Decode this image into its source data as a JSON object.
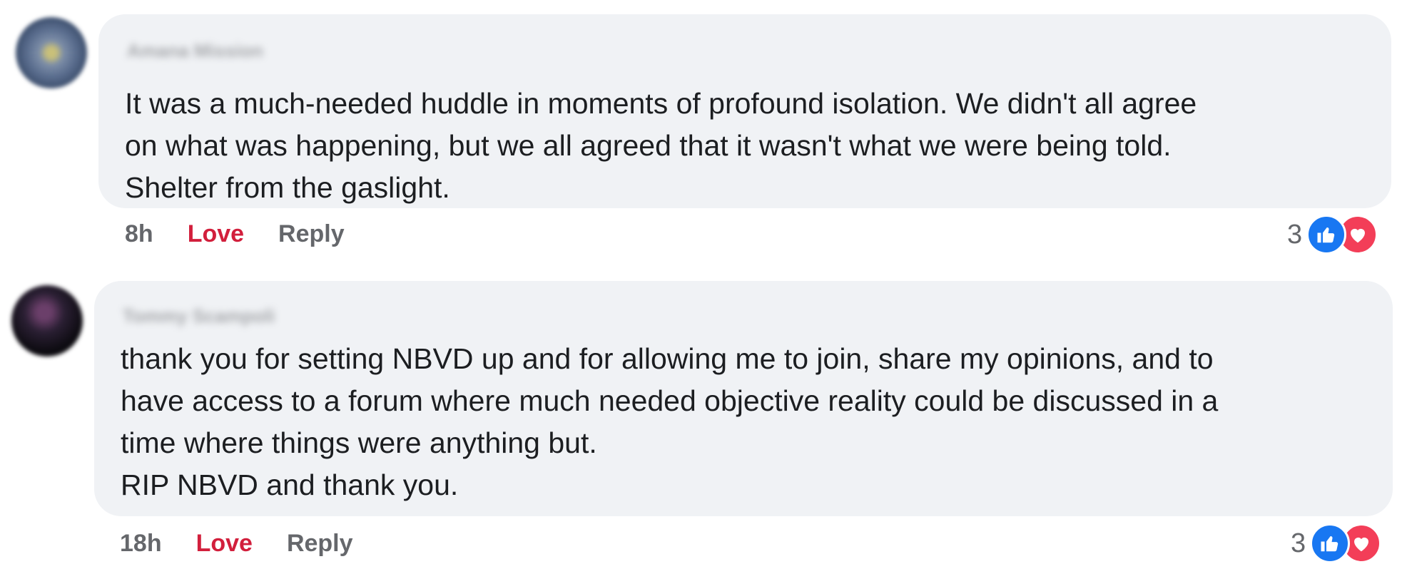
{
  "comments": [
    {
      "author": "Amana Mission",
      "text": "It was a much-needed huddle in moments of profound isolation. We didn't all agree\non what was happening, but we all agreed that it wasn't what we were being told.\nShelter from the gaslight.",
      "time": "8h",
      "love_label": "Love",
      "reply_label": "Reply",
      "reaction_count": "3",
      "reactions": [
        "like-icon",
        "heart-icon"
      ]
    },
    {
      "author": "Tommy Scampoli",
      "text": "thank you for setting NBVD up and for allowing me to join, share my opinions, and to\nhave access to a forum where much needed objective reality could be discussed in a\ntime where things were anything but.\nRIP NBVD and thank you.",
      "time": "18h",
      "love_label": "Love",
      "reply_label": "Reply",
      "reaction_count": "3",
      "reactions": [
        "like-icon",
        "heart-icon"
      ]
    }
  ],
  "colors": {
    "bubble": "#f0f2f5",
    "love": "#d21f3c",
    "like": "#1877f2",
    "heart": "#f33e58",
    "meta": "#65676b"
  }
}
